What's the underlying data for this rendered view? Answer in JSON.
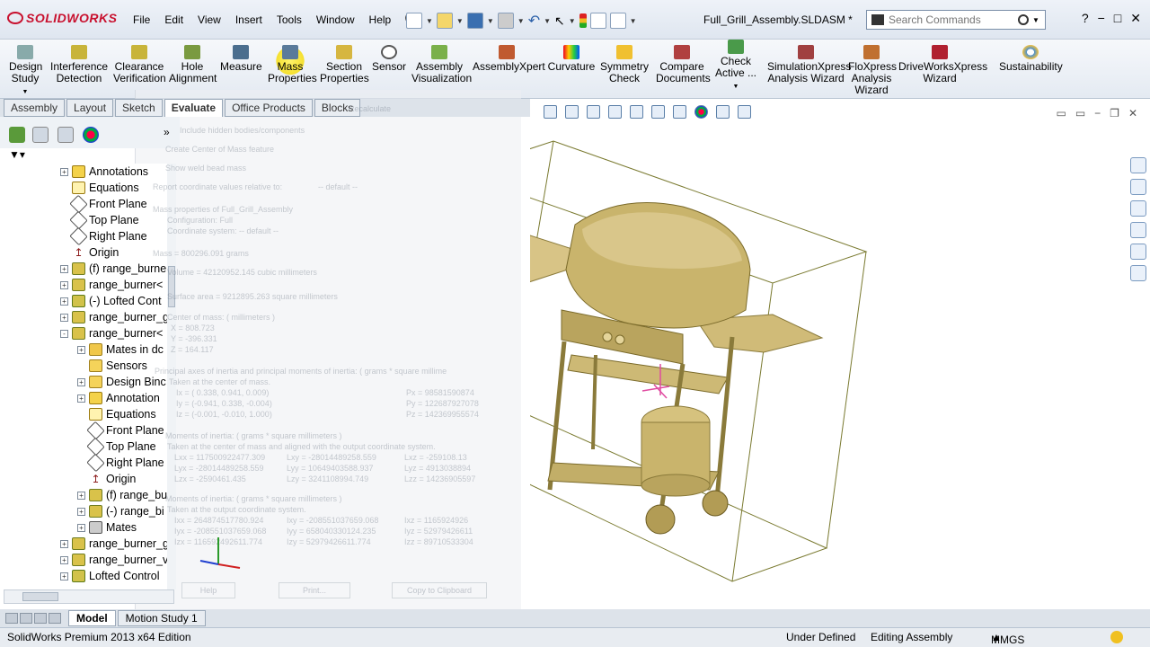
{
  "app": {
    "logo_text": "SOLIDWORKS",
    "document_title": "Full_Grill_Assembly.SLDASM *"
  },
  "menu": [
    "File",
    "Edit",
    "View",
    "Insert",
    "Tools",
    "Window",
    "Help"
  ],
  "search": {
    "placeholder": "Search Commands"
  },
  "ribbon": [
    {
      "label1": "Design",
      "label2": "Study",
      "icon": "design-study-icon"
    },
    {
      "label1": "Interference",
      "label2": "Detection",
      "icon": "interference-detection-icon"
    },
    {
      "label1": "Clearance",
      "label2": "Verification",
      "icon": "clearance-verification-icon"
    },
    {
      "label1": "Hole",
      "label2": "Alignment",
      "icon": "hole-alignment-icon"
    },
    {
      "label1": "Measure",
      "label2": "",
      "icon": "measure-icon"
    },
    {
      "label1": "Mass",
      "label2": "Properties",
      "icon": "mass-properties-icon"
    },
    {
      "label1": "Section",
      "label2": "Properties",
      "icon": "section-properties-icon"
    },
    {
      "label1": "Sensor",
      "label2": "",
      "icon": "sensor-icon"
    },
    {
      "label1": "Assembly",
      "label2": "Visualization",
      "icon": "assembly-visualization-icon"
    },
    {
      "label1": "AssemblyXpert",
      "label2": "",
      "icon": "assemblyxpert-icon"
    },
    {
      "label1": "Curvature",
      "label2": "",
      "icon": "curvature-icon"
    },
    {
      "label1": "Symmetry",
      "label2": "Check",
      "icon": "symmetry-check-icon"
    },
    {
      "label1": "Compare",
      "label2": "Documents",
      "icon": "compare-documents-icon"
    },
    {
      "label1": "Check",
      "label2": "Active ...",
      "icon": "check-active-icon"
    },
    {
      "label1": "SimulationXpress",
      "label2": "Analysis Wizard",
      "icon": "simulationxpress-icon"
    },
    {
      "label1": "FloXpress",
      "label2": "Analysis",
      "label3": "Wizard",
      "icon": "floxpress-icon"
    },
    {
      "label1": "DriveWorksXpress",
      "label2": "Wizard",
      "icon": "driveworksxpress-icon"
    },
    {
      "label1": "Sustainability",
      "label2": "",
      "icon": "sustainability-icon"
    }
  ],
  "command_tabs": [
    {
      "label": "Assembly",
      "active": false
    },
    {
      "label": "Layout",
      "active": false
    },
    {
      "label": "Sketch",
      "active": false
    },
    {
      "label": "Evaluate",
      "active": true
    },
    {
      "label": "Office Products",
      "active": false
    },
    {
      "label": "Blocks",
      "active": false
    }
  ],
  "tree": [
    {
      "label": "Annotations",
      "icon": "annotations-icon",
      "indent": 0,
      "exp": "+"
    },
    {
      "label": "Equations",
      "icon": "equations-icon",
      "indent": 0,
      "exp": ""
    },
    {
      "label": "Front Plane",
      "icon": "plane-icon",
      "indent": 0,
      "exp": ""
    },
    {
      "label": "Top Plane",
      "icon": "plane-icon",
      "indent": 0,
      "exp": ""
    },
    {
      "label": "Right Plane",
      "icon": "plane-icon",
      "indent": 0,
      "exp": ""
    },
    {
      "label": "Origin",
      "icon": "origin-icon",
      "indent": 0,
      "exp": ""
    },
    {
      "label": "(f) range_burne",
      "icon": "part-icon",
      "indent": 0,
      "exp": "+"
    },
    {
      "label": "range_burner<",
      "icon": "part-icon",
      "indent": 0,
      "exp": "+"
    },
    {
      "label": "(-) Lofted Cont",
      "icon": "lofted-icon",
      "indent": 0,
      "exp": "+"
    },
    {
      "label": "range_burner_g",
      "icon": "part-icon",
      "indent": 0,
      "exp": "+"
    },
    {
      "label": "range_burner<",
      "icon": "part-icon",
      "indent": 0,
      "exp": "-"
    },
    {
      "label": "Mates in dc",
      "icon": "folder-icon",
      "indent": 1,
      "exp": "+"
    },
    {
      "label": "Sensors",
      "icon": "sensors-icon",
      "indent": 1,
      "exp": ""
    },
    {
      "label": "Design Binc",
      "icon": "design-binder-icon",
      "indent": 1,
      "exp": "+"
    },
    {
      "label": "Annotation",
      "icon": "annotations-icon",
      "indent": 1,
      "exp": "+"
    },
    {
      "label": "Equations",
      "icon": "equations-icon",
      "indent": 1,
      "exp": ""
    },
    {
      "label": "Front Plane",
      "icon": "plane-icon",
      "indent": 1,
      "exp": ""
    },
    {
      "label": "Top Plane",
      "icon": "plane-icon",
      "indent": 1,
      "exp": ""
    },
    {
      "label": "Right Plane",
      "icon": "plane-icon",
      "indent": 1,
      "exp": ""
    },
    {
      "label": "Origin",
      "icon": "origin-icon",
      "indent": 1,
      "exp": ""
    },
    {
      "label": "(f) range_bu",
      "icon": "part-icon",
      "indent": 1,
      "exp": "+"
    },
    {
      "label": "(-) range_bi",
      "icon": "part-icon",
      "indent": 1,
      "exp": "+"
    },
    {
      "label": "Mates",
      "icon": "mates-icon",
      "indent": 1,
      "exp": "+"
    },
    {
      "label": "range_burner_g",
      "icon": "part-icon",
      "indent": 0,
      "exp": "+"
    },
    {
      "label": "range_burner_v",
      "icon": "part-icon",
      "indent": 0,
      "exp": "+"
    },
    {
      "label": "Lofted Control",
      "icon": "lofted-icon",
      "indent": 0,
      "exp": "+"
    }
  ],
  "bottom_tabs": [
    {
      "label": "Model",
      "active": true
    },
    {
      "label": "Motion Study 1",
      "active": false
    }
  ],
  "status": {
    "edition": "SolidWorks Premium 2013 x64 Edition",
    "state": "Under Defined",
    "mode": "Editing Assembly",
    "units": "MMGS"
  },
  "mass_dialog": {
    "lines": [
      "Include hidden bodies/components",
      "Create Center of Mass feature",
      "Show weld bead mass",
      "Report coordinate values relative to:",
      "-- default --",
      "Mass properties of Full_Grill_Assembly",
      "Configuration: Full",
      "Coordinate system: -- default --",
      "Mass = 800296.091 grams",
      "Volume = 42120952.145 cubic millimeters",
      "Surface area = 9212895.263 square millimeters",
      "Center of mass: ( millimeters )",
      "X = 808.723",
      "Y = -396.331",
      "Z = 164.117",
      "Principal axes of inertia and principal moments of inertia: ( grams * square millime",
      "Taken at the center of mass.",
      "Ix = ( 0.338, 0.941, 0.009)",
      "Iy = (-0.941, 0.338, -0.004)",
      "Iz = (-0.001, -0.010, 1.000)",
      "Px = 98581590874",
      "Py = 122687927078",
      "Pz = 142369955574",
      "Moments of inertia: ( grams * square millimeters )",
      "Taken at the center of mass and aligned with the output coordinate system.",
      "Lxx = 117500922477.309",
      "Lxy = -28014489258.559",
      "Lxz = -259108.13",
      "Lyx = -28014489258.559",
      "Lyy = 10649403588.937",
      "Lyz = 4913038894",
      "Lzx = -2590461.435",
      "Lzy = 3241108994.749",
      "Lzz = 14236905597",
      "Moments of inertia: ( grams * square millimeters )",
      "Taken at the output coordinate system.",
      "Ixx = 264874517780.924",
      "Ixy = -208551037659.068",
      "Ixz = 1165924926",
      "Iyx = -208551037659.068",
      "Iyy = 658040330124.235",
      "Iyz = 52979426611",
      "Izx = 116592492611.774",
      "Izy = 52979426611.774",
      "Izz = 89710533304"
    ],
    "buttons": [
      "Help",
      "Print...",
      "Copy to Clipboard"
    ],
    "recalc": "Recalculate"
  }
}
